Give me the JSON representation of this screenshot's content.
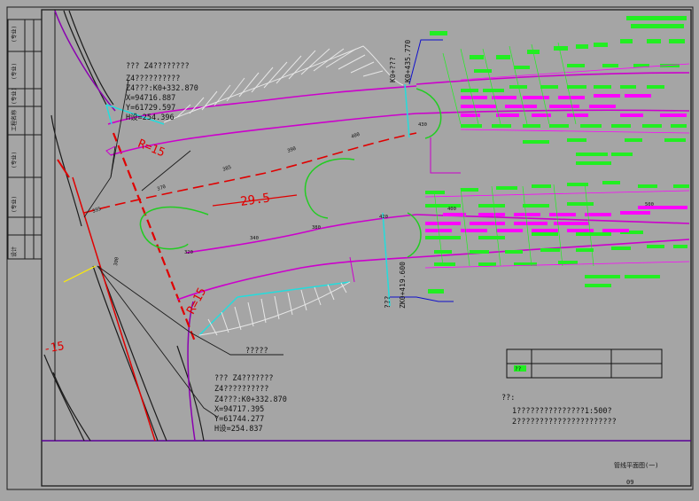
{
  "colors": {
    "background": "#a5a5a5",
    "frame": "#1b1b1b",
    "road_edge": "#cc00cc",
    "dimension": "#e00000",
    "label_green": "#22ee22",
    "label_pink": "#ff00ff",
    "callout_blue": "#0000cc",
    "curb_cyan": "#22dddd",
    "hatch": "#e0e0e0",
    "text_black": "#111111"
  },
  "annotations": {
    "top_point": {
      "title": "??? Z4????????",
      "line2": "Z4??????????",
      "line3": "Z4???:K0+332.870",
      "x": "X=94716.887",
      "y": "Y=61729.597",
      "h": "H设=254.396"
    },
    "bottom_point": {
      "title": "??? Z4???????",
      "line2": "Z4??????????",
      "line3": "Z4???:K0+332.870",
      "x": "X=94717.395",
      "y": "Y=61744.277",
      "h": "H设=254.837"
    },
    "leader_label": "?????",
    "radius_top": "R=15",
    "radius_bottom": "R=15",
    "radius_left": "-15",
    "width_dim": "29.5",
    "station_top": "K0+435.770",
    "station_top_prefix": "K0+???",
    "station_bottom": "ZK0+419.600",
    "station_bottom_prefix": "???",
    "stations": [
      "395",
      "370",
      "385",
      "390",
      "400",
      "420",
      "430",
      "300",
      "320",
      "340",
      "380",
      "400",
      "500"
    ]
  },
  "notes": {
    "header": "??:",
    "line1": "1???????????????1:500?",
    "line2": "2??????????????????????"
  },
  "title_block": {
    "cell1": "??",
    "drawing_name": "管线平面图(一)",
    "sheet_no": "09"
  },
  "left_strip": [
    "(专业)",
    "(专业)",
    "(专业)",
    "工程名称",
    "(专业)",
    "(专业)",
    "设计"
  ]
}
